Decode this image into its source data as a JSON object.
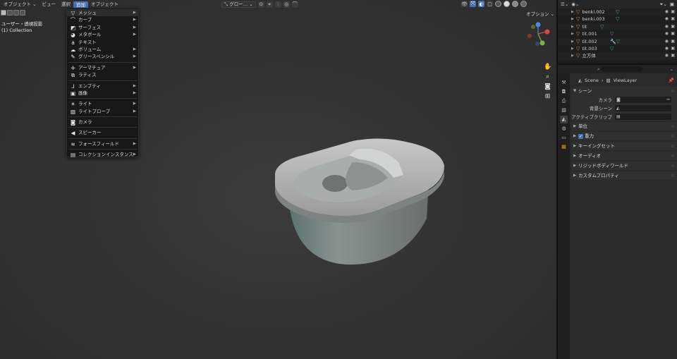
{
  "header": {
    "menus": [
      "オブジェクト",
      "ビュー",
      "選択",
      "追加",
      "オブジェクト"
    ],
    "transform_orientation": "グロー…",
    "options_label": "オプション"
  },
  "viewport_info": {
    "view_name": "ユーザー・透視投影",
    "collection": "(1) Collection"
  },
  "add_menu": {
    "items": [
      {
        "label": "メッシュ",
        "icon": "mesh-icon",
        "glyph": "▽",
        "submenu": true
      },
      {
        "label": "カーブ",
        "icon": "curve-icon",
        "glyph": "⌒",
        "submenu": true
      },
      {
        "label": "サーフェス",
        "icon": "surface-icon",
        "glyph": "◩",
        "submenu": true
      },
      {
        "label": "メタボール",
        "icon": "metaball-icon",
        "glyph": "◕",
        "submenu": true
      },
      {
        "label": "テキスト",
        "icon": "text-icon",
        "glyph": "a",
        "submenu": false
      },
      {
        "label": "ボリューム",
        "icon": "volume-icon",
        "glyph": "☁",
        "submenu": true
      },
      {
        "label": "グリースペンシル",
        "icon": "grease-pencil-icon",
        "glyph": "✎",
        "submenu": true
      },
      {
        "label": "アーマチュア",
        "icon": "armature-icon",
        "glyph": "✛",
        "submenu": true
      },
      {
        "label": "ラティス",
        "icon": "lattice-icon",
        "glyph": "⧉",
        "submenu": false
      },
      {
        "label": "エンプティ",
        "icon": "empty-icon",
        "glyph": "⅃",
        "submenu": true
      },
      {
        "label": "画像",
        "icon": "image-icon",
        "glyph": "▣",
        "submenu": true
      },
      {
        "label": "ライト",
        "icon": "light-icon",
        "glyph": "☀",
        "submenu": true
      },
      {
        "label": "ライトプローブ",
        "icon": "light-probe-icon",
        "glyph": "▨",
        "submenu": true
      },
      {
        "label": "カメラ",
        "icon": "camera-icon",
        "glyph": "◙",
        "submenu": false
      },
      {
        "label": "スピーカー",
        "icon": "speaker-icon",
        "glyph": "◀",
        "submenu": false
      },
      {
        "label": "フォースフィールド",
        "icon": "force-field-icon",
        "glyph": "≋",
        "submenu": true
      },
      {
        "label": "コレクションインスタンス",
        "icon": "collection-instance-icon",
        "glyph": "▤",
        "submenu": true
      }
    ]
  },
  "outliner": {
    "rows": [
      "benki.002",
      "benki.003",
      "tit",
      "tit.001",
      "tit.002",
      "tit.003",
      "立方体"
    ]
  },
  "properties": {
    "search_placeholder": "",
    "breadcrumb": {
      "scene": "Scene",
      "view_layer": "ViewLayer"
    },
    "scene_panel": {
      "title": "シーン",
      "fields": [
        {
          "label": "カメラ",
          "value": ""
        },
        {
          "label": "背景シーン",
          "value": ""
        },
        {
          "label": "アクティブクリップ",
          "value": ""
        }
      ]
    },
    "collapsed_panels": [
      "単位",
      "重力",
      "キーイングセット",
      "オーディオ",
      "リジッドボディワールド",
      "カスタムプロパティ"
    ],
    "gravity_checked": true
  },
  "colors": {
    "accent": "#4772b3",
    "object_icon": "#e3823b",
    "modifier_icon": "#48b07a"
  }
}
